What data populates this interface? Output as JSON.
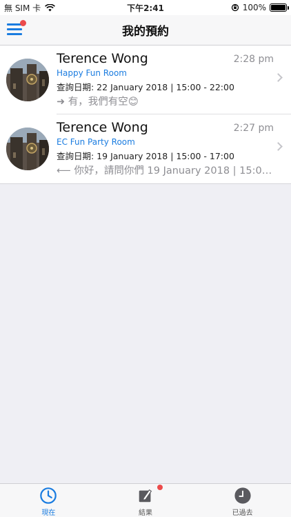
{
  "status_bar": {
    "carrier": "無 SIM 卡",
    "time": "下午2:41",
    "battery": "100%"
  },
  "nav": {
    "title": "我的預約"
  },
  "bookings": [
    {
      "name": "Terence Wong",
      "time": "2:28 pm",
      "room": "Happy Fun Room",
      "date": "查詢日期: 22 January 2018 | 15:00 - 22:00",
      "message": "有，我們有空😊",
      "direction": "outgoing"
    },
    {
      "name": "Terence Wong",
      "time": "2:27 pm",
      "room": "EC Fun Party Room",
      "date": "查詢日期: 19 January 2018 | 15:00 - 17:00",
      "message": "你好，請問你們 19 January 2018 | 15:00 ...",
      "direction": "incoming"
    }
  ],
  "tabs": [
    {
      "label": "現在",
      "icon": "clock-icon"
    },
    {
      "label": "結果",
      "icon": "edit-icon"
    },
    {
      "label": "已過去",
      "icon": "history-clock-icon"
    }
  ],
  "colors": {
    "accent": "#1a7ce0",
    "badge": "#ec4b4b",
    "background": "#efeff4"
  }
}
